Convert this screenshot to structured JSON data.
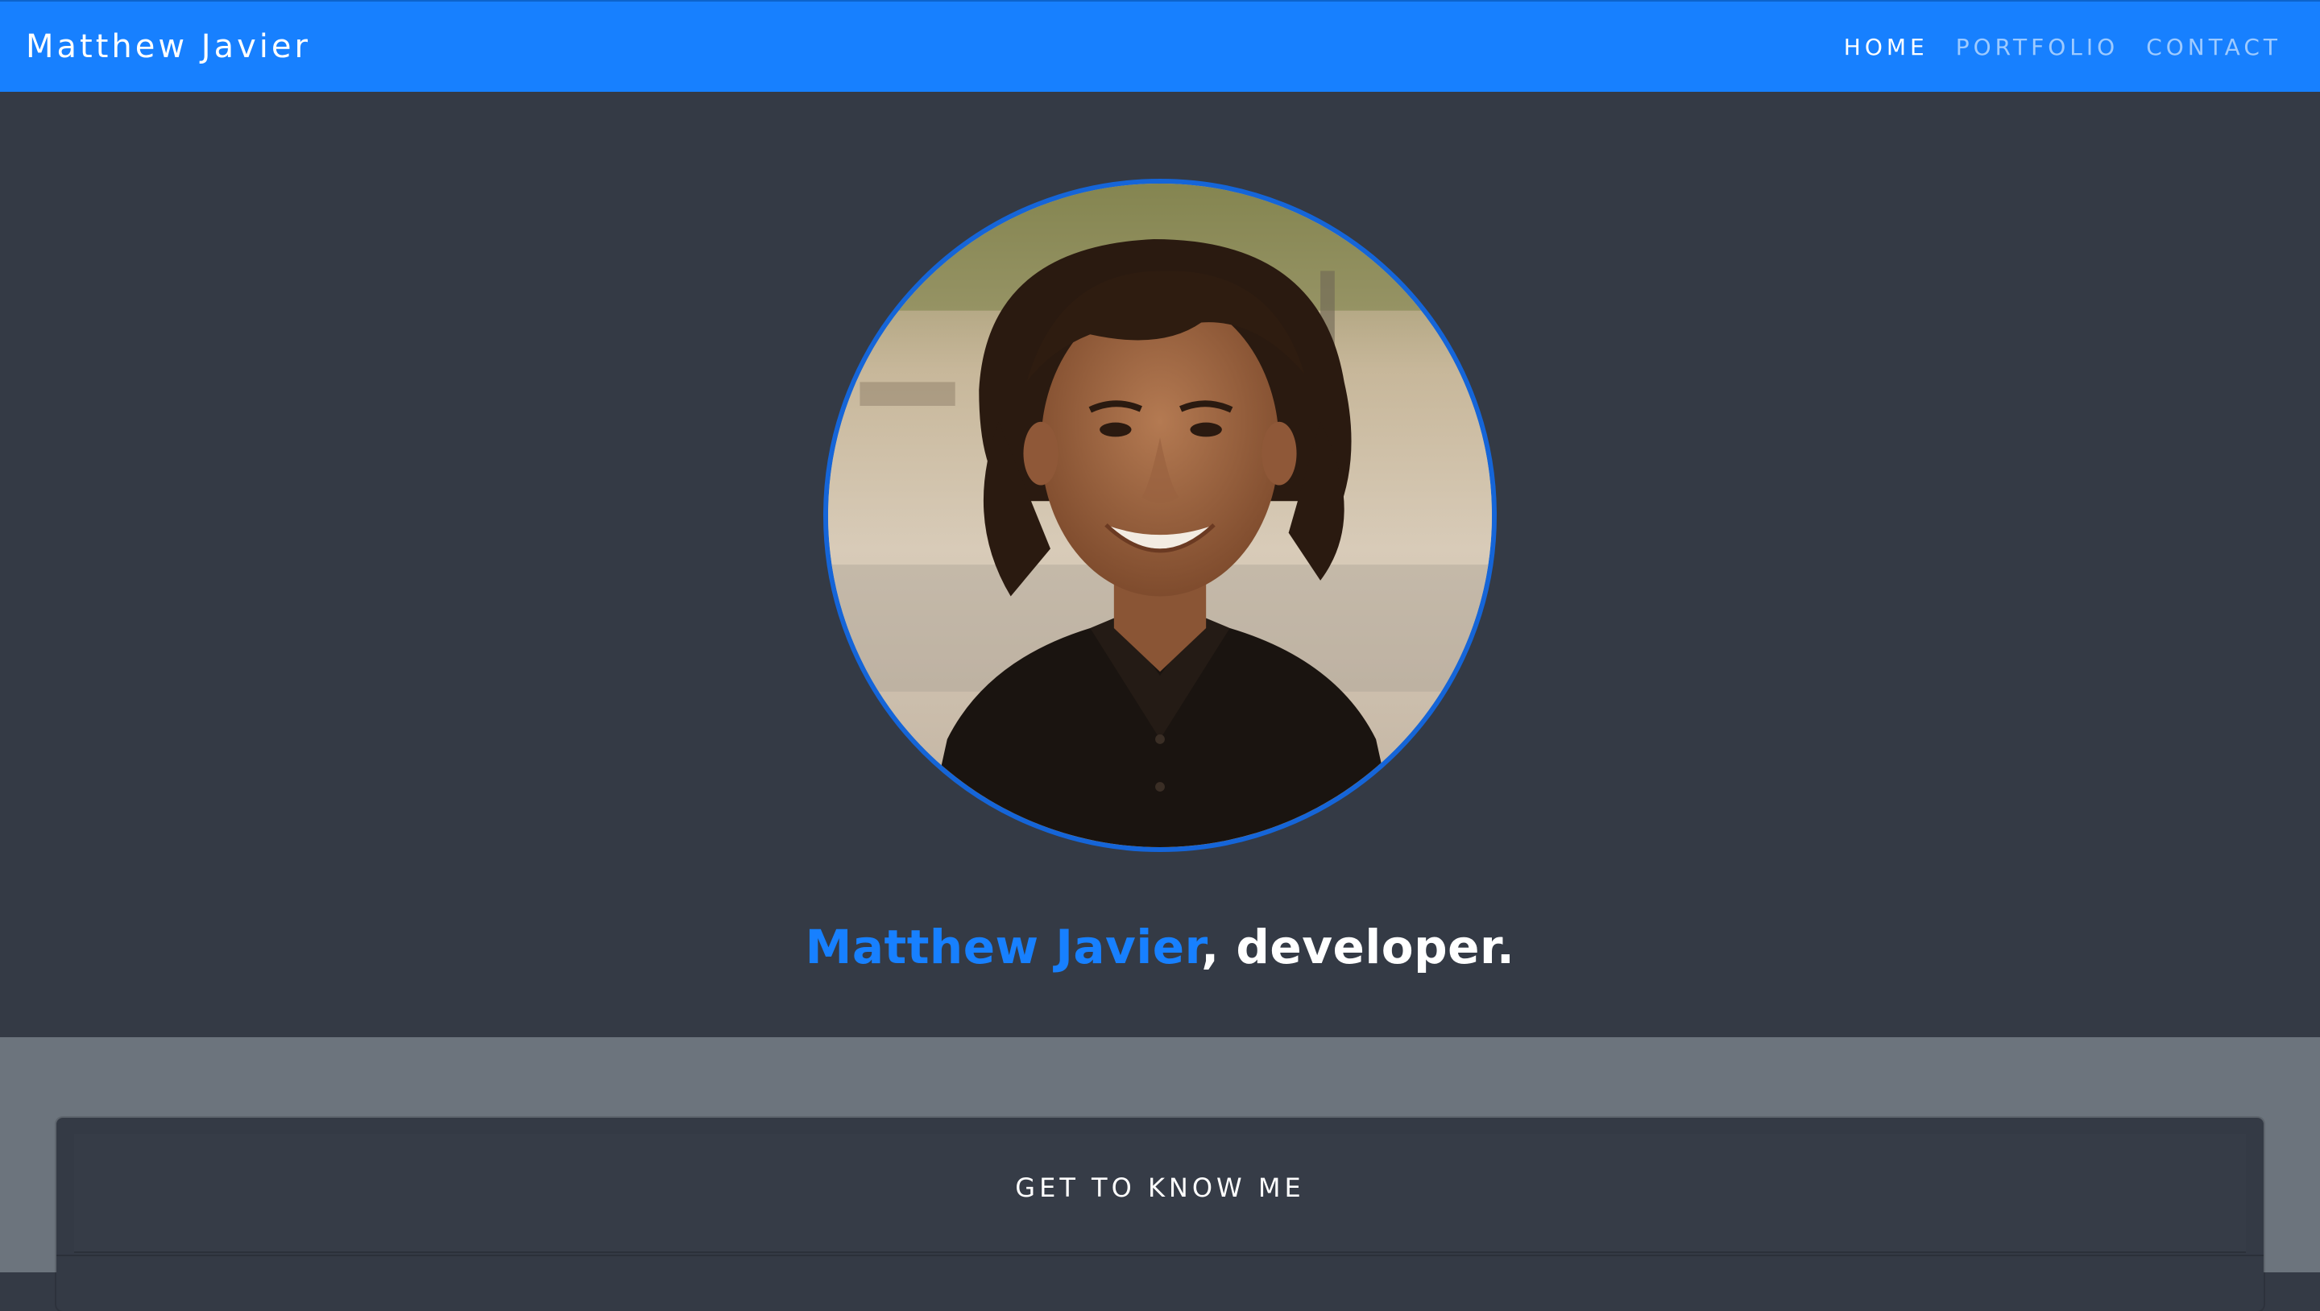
{
  "navbar": {
    "brand": "Matthew Javier",
    "links": [
      {
        "label": "HOME",
        "active": true
      },
      {
        "label": "PORTFOLIO",
        "active": false
      },
      {
        "label": "CONTACT",
        "active": false
      }
    ]
  },
  "hero": {
    "avatar_icon": "profile-photo",
    "tagline_name": "Matthew Javier",
    "tagline_rest": ", developer."
  },
  "about": {
    "card_title": "GET TO KNOW ME"
  },
  "colors": {
    "accent": "#1780ff",
    "hero_bg": "#343a45",
    "section_bg": "#6c747d",
    "avatar_border": "#1565d8"
  }
}
